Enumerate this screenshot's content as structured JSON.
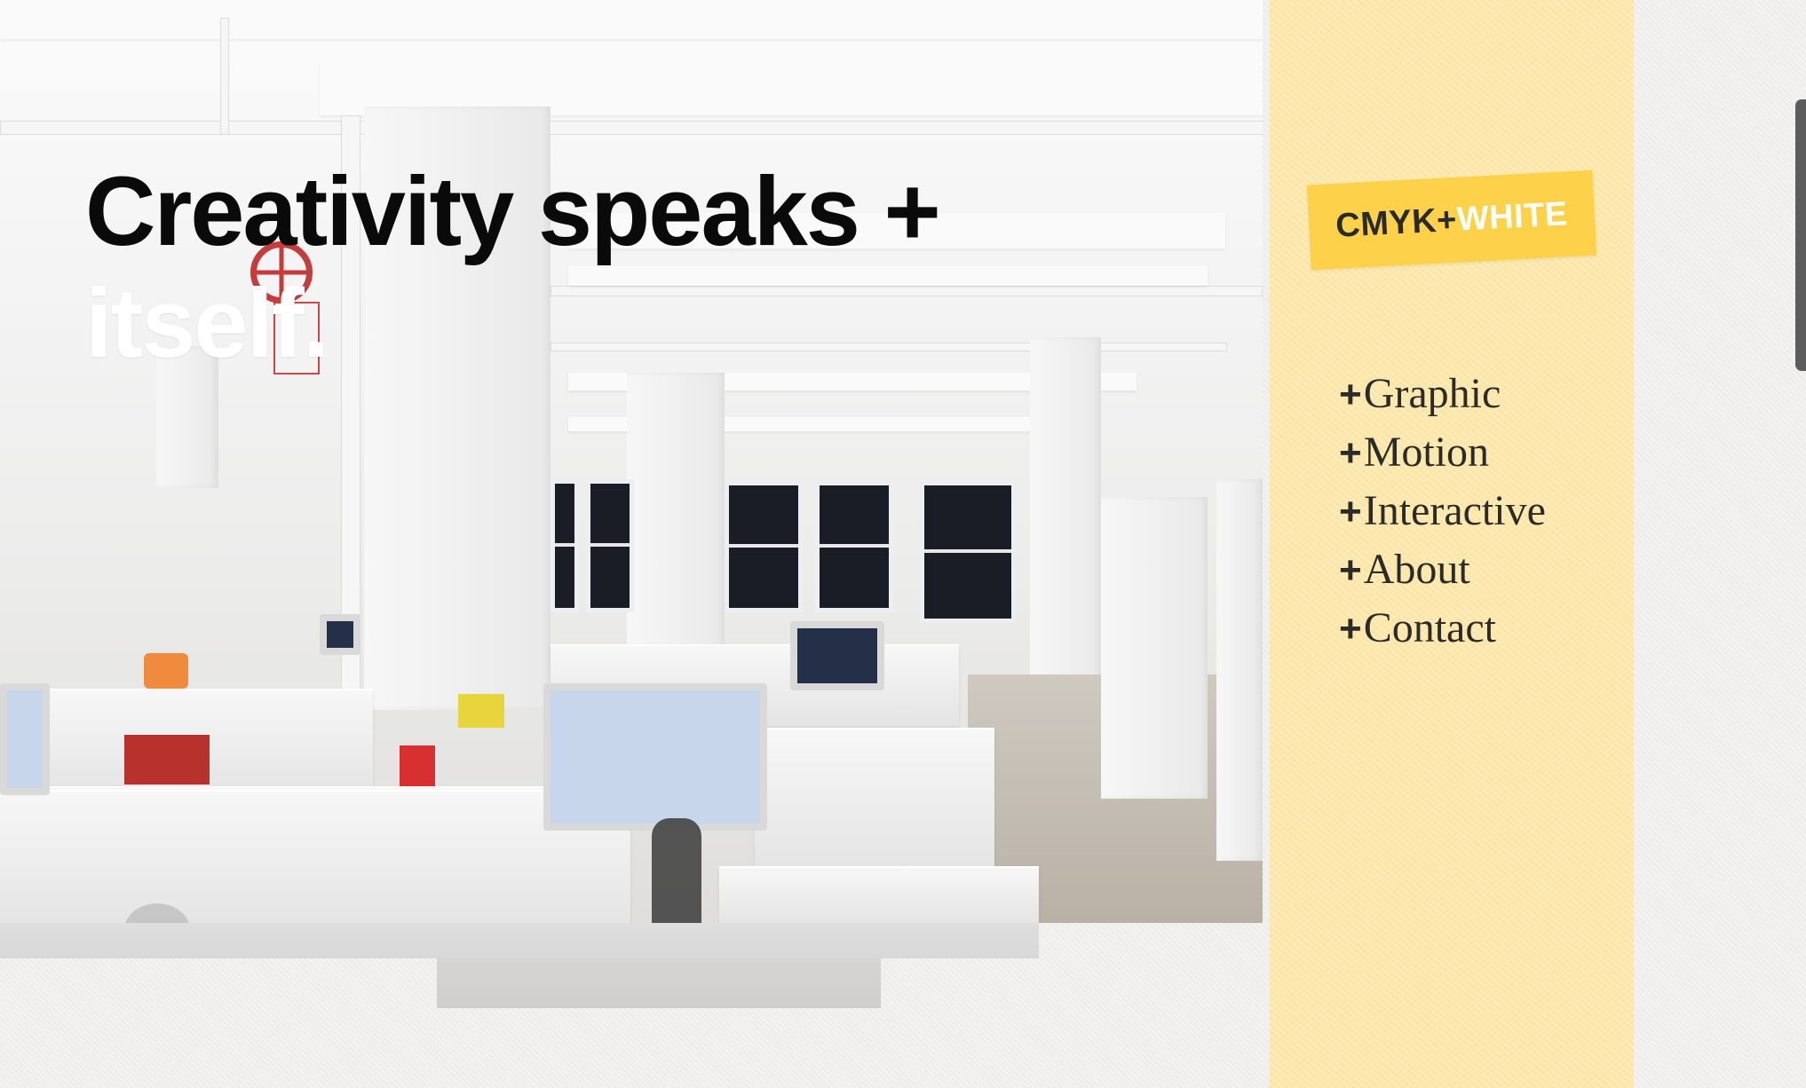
{
  "hero": {
    "headline_line_1": "Creativity speaks +",
    "headline_line_2": "itself.",
    "image_alt": "Open-plan office interior with white cubicles, computers and tall windows"
  },
  "sidebar": {
    "logo": {
      "part_1": "CMYK",
      "plus": "+",
      "part_2": "WHITE"
    },
    "nav": [
      {
        "plus": "+",
        "label": "Graphic"
      },
      {
        "plus": "+",
        "label": "Motion"
      },
      {
        "plus": "+",
        "label": "Interactive"
      },
      {
        "plus": "+",
        "label": "About"
      },
      {
        "plus": "+",
        "label": "Contact"
      }
    ]
  },
  "colors": {
    "sidebar_bg": "#fde9ae",
    "logo_bg": "#fdd24a",
    "headline_dark": "#0a0a0a",
    "headline_light": "#ffffff",
    "nav_text": "#2c2b28"
  },
  "icons": {
    "scrollbar": "vertical-scrollbar-thumb"
  }
}
